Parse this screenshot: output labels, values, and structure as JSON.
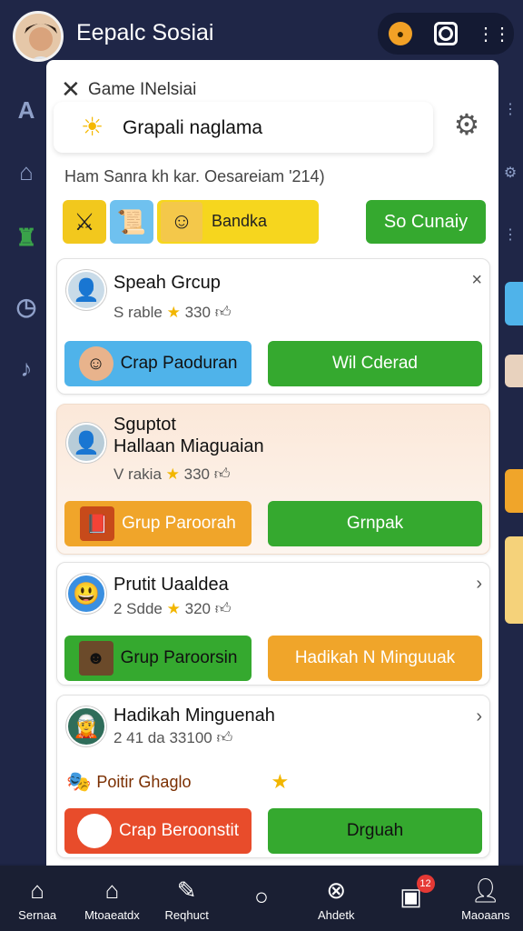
{
  "app": {
    "title": "Eepalc Sosiai"
  },
  "topbar": {
    "icons": [
      "notification-badge-icon",
      "camera-icon",
      "more-dots-icon"
    ]
  },
  "modal": {
    "title": "Game INelsiai",
    "group_name": "Grapali naglama",
    "subtitle": "Ham Sanra kh kar. Oesareiam '214)",
    "chips": [
      {
        "icon": "crossed-swords-icon",
        "color": "#f2c81d"
      },
      {
        "icon": "scroll-icon",
        "color": "#6fc1ef"
      }
    ],
    "chip_wide_label": "Bandka",
    "go_button": "So Cunaiy"
  },
  "cards": [
    {
      "title": "Speah Grcup",
      "meta_prefix": "S rable",
      "meta_value": "330",
      "action": "×",
      "button_left": "Crap Paoduran",
      "button_right": "Wil Cderad"
    },
    {
      "title_line1": "Sguptot",
      "title_line2": "Hallaan Miaguaian",
      "meta_prefix": "V rakia",
      "meta_value": "330",
      "button_left": "Grup Paroorah",
      "button_right": "Grnpak"
    },
    {
      "title": "Prutit Uaaldea",
      "meta_prefix": "2 Sdde",
      "meta_value": "320",
      "action": "›",
      "button_left": "Grup Paroorsin",
      "button_right": "Hadikah N Minguuak"
    },
    {
      "title": "Hadikah Minguenah",
      "meta_prefix": "2 41 da",
      "meta_value": "33100",
      "action": "›",
      "extra_label": "Poitir Ghaglo",
      "button_left": "Crap Beroonstit",
      "button_right": "Drguah"
    }
  ],
  "bottom_nav": [
    {
      "label": "Sernaa",
      "icon": "home-icon"
    },
    {
      "label": "Mtoaeatdx",
      "icon": "house-alt-icon"
    },
    {
      "label": "Reqhuct",
      "icon": "pen-icon"
    },
    {
      "label": "",
      "icon": "circle-icon"
    },
    {
      "label": "Ahdetk",
      "icon": "crossed-circle-icon"
    },
    {
      "label": "",
      "icon": "chat-icon",
      "badge": "12"
    },
    {
      "label": "Maoaans",
      "icon": "person-icon"
    }
  ],
  "colors": {
    "background": "#1c2342",
    "green": "#35a92f",
    "blue": "#4fb3ea",
    "orange": "#f0a52a",
    "red": "#e84c2b",
    "yellow": "#f6d61e"
  }
}
